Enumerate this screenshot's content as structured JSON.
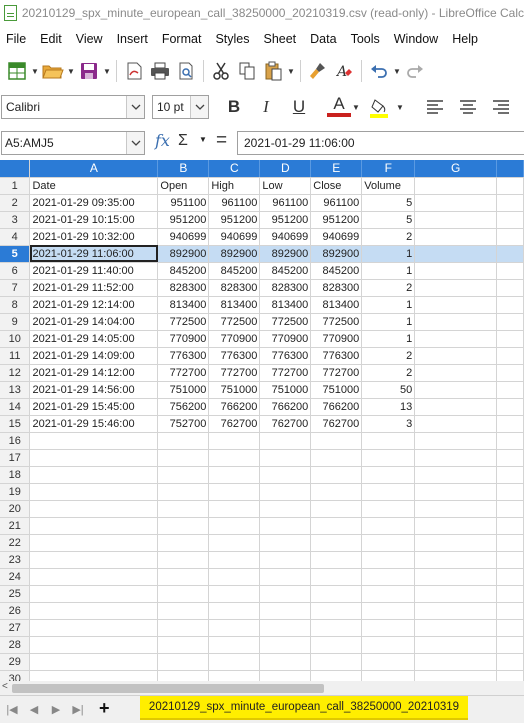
{
  "window": {
    "title": "20210129_spx_minute_european_call_38250000_20210319.csv (read-only) - LibreOffice Calc"
  },
  "menu": [
    "File",
    "Edit",
    "View",
    "Insert",
    "Format",
    "Styles",
    "Sheet",
    "Data",
    "Tools",
    "Window",
    "Help"
  ],
  "format": {
    "font_name": "Calibri",
    "font_size": "10 pt",
    "bold": "B",
    "italic": "I",
    "underline": "U",
    "font_color": "A"
  },
  "formula_bar": {
    "name_box": "A5:AMJ5",
    "content": "2021-01-29 11:06:00",
    "fx": "fx",
    "sum": "Σ",
    "equals": "="
  },
  "columns": [
    "A",
    "B",
    "C",
    "D",
    "E",
    "F",
    "G"
  ],
  "rows": [
    [
      "Date",
      "Open",
      "High",
      "Low",
      "Close",
      "Volume"
    ],
    [
      "2021-01-29 09:35:00",
      "951100",
      "961100",
      "961100",
      "961100",
      "5"
    ],
    [
      "2021-01-29 10:15:00",
      "951200",
      "951200",
      "951200",
      "951200",
      "5"
    ],
    [
      "2021-01-29 10:32:00",
      "940699",
      "940699",
      "940699",
      "940699",
      "2"
    ],
    [
      "2021-01-29 11:06:00",
      "892900",
      "892900",
      "892900",
      "892900",
      "1"
    ],
    [
      "2021-01-29 11:40:00",
      "845200",
      "845200",
      "845200",
      "845200",
      "1"
    ],
    [
      "2021-01-29 11:52:00",
      "828300",
      "828300",
      "828300",
      "828300",
      "2"
    ],
    [
      "2021-01-29 12:14:00",
      "813400",
      "813400",
      "813400",
      "813400",
      "1"
    ],
    [
      "2021-01-29 14:04:00",
      "772500",
      "772500",
      "772500",
      "772500",
      "1"
    ],
    [
      "2021-01-29 14:05:00",
      "770900",
      "770900",
      "770900",
      "770900",
      "1"
    ],
    [
      "2021-01-29 14:09:00",
      "776300",
      "776300",
      "776300",
      "776300",
      "2"
    ],
    [
      "2021-01-29 14:12:00",
      "772700",
      "772700",
      "772700",
      "772700",
      "2"
    ],
    [
      "2021-01-29 14:56:00",
      "751000",
      "751000",
      "751000",
      "751000",
      "50"
    ],
    [
      "2021-01-29 15:45:00",
      "756200",
      "766200",
      "766200",
      "766200",
      "13"
    ],
    [
      "2021-01-29 15:46:00",
      "752700",
      "762700",
      "762700",
      "762700",
      "3"
    ]
  ],
  "row_count": 30,
  "active_row": 5,
  "sheet_tab": "20210129_spx_minute_european_call_38250000_20210319",
  "colors": {
    "header_blue": "#2b7bd6",
    "selection": "#c5dcf3",
    "tab_yellow": "#ffee00"
  }
}
